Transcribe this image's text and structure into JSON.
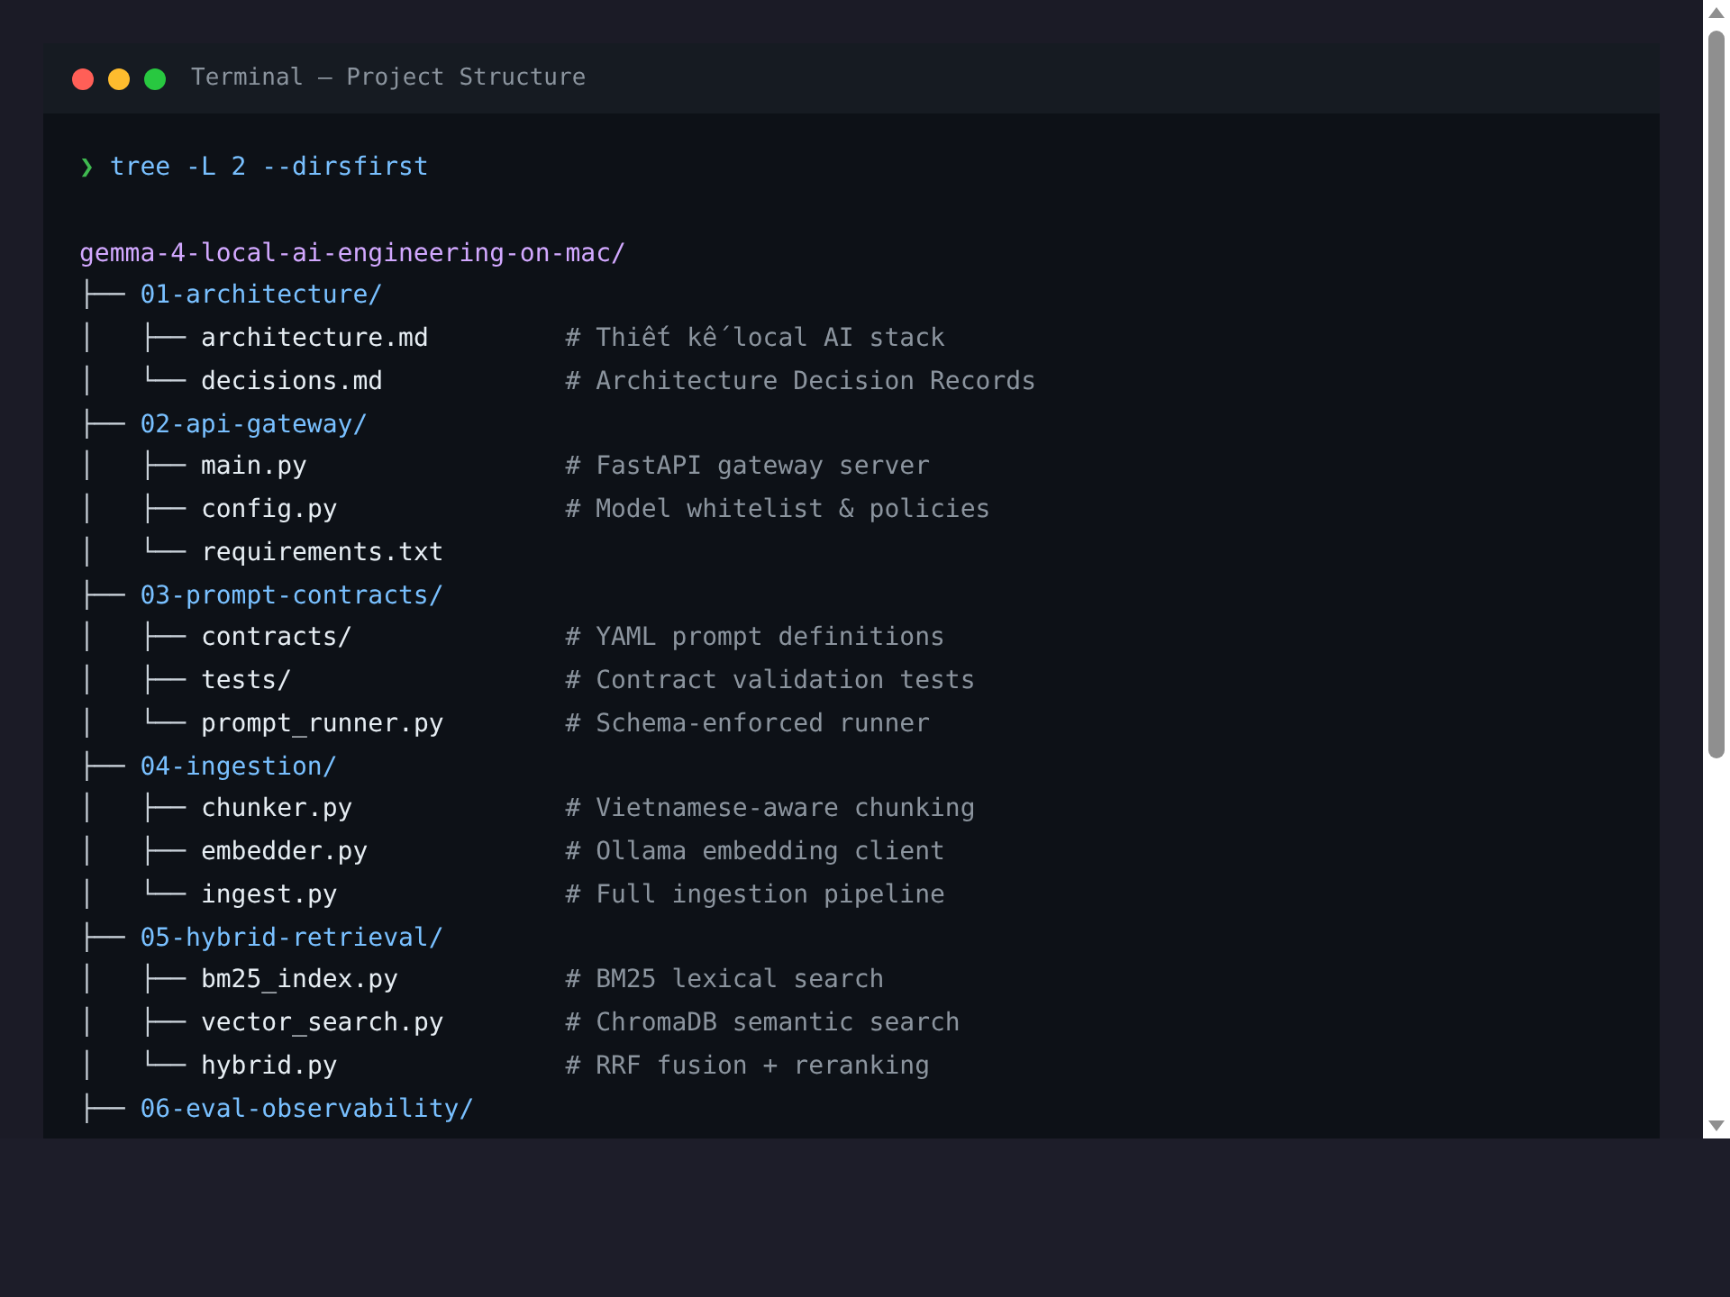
{
  "window": {
    "title": "Terminal — Project Structure"
  },
  "command": {
    "prompt": "❯",
    "text": "tree -L 2 --dirsfirst"
  },
  "tree": {
    "name": "gemma-4-local-ai-engineering-on-mac/",
    "children": [
      {
        "prefix": "├── ",
        "name": "01-architecture/",
        "children": [
          {
            "prefix": "│   ├── ",
            "name": "architecture.md",
            "comment": "# Thiết kế local AI stack"
          },
          {
            "prefix": "│   └── ",
            "name": "decisions.md",
            "comment": "# Architecture Decision Records"
          }
        ]
      },
      {
        "prefix": "├── ",
        "name": "02-api-gateway/",
        "children": [
          {
            "prefix": "│   ├── ",
            "name": "main.py",
            "comment": "# FastAPI gateway server"
          },
          {
            "prefix": "│   ├── ",
            "name": "config.py",
            "comment": "# Model whitelist & policies"
          },
          {
            "prefix": "│   └── ",
            "name": "requirements.txt"
          }
        ]
      },
      {
        "prefix": "├── ",
        "name": "03-prompt-contracts/",
        "children": [
          {
            "prefix": "│   ├── ",
            "name": "contracts/",
            "comment": "# YAML prompt definitions"
          },
          {
            "prefix": "│   ├── ",
            "name": "tests/",
            "comment": "# Contract validation tests"
          },
          {
            "prefix": "│   └── ",
            "name": "prompt_runner.py",
            "comment": "# Schema-enforced runner"
          }
        ]
      },
      {
        "prefix": "├── ",
        "name": "04-ingestion/",
        "children": [
          {
            "prefix": "│   ├── ",
            "name": "chunker.py",
            "comment": "# Vietnamese-aware chunking"
          },
          {
            "prefix": "│   ├── ",
            "name": "embedder.py",
            "comment": "# Ollama embedding client"
          },
          {
            "prefix": "│   └── ",
            "name": "ingest.py",
            "comment": "# Full ingestion pipeline"
          }
        ]
      },
      {
        "prefix": "├── ",
        "name": "05-hybrid-retrieval/",
        "children": [
          {
            "prefix": "│   ├── ",
            "name": "bm25_index.py",
            "comment": "# BM25 lexical search"
          },
          {
            "prefix": "│   ├── ",
            "name": "vector_search.py",
            "comment": "# ChromaDB semantic search"
          },
          {
            "prefix": "│   └── ",
            "name": "hybrid.py",
            "comment": "# RRF fusion + reranking"
          }
        ]
      },
      {
        "prefix": "├── ",
        "name": "06-eval-observability/"
      }
    ]
  }
}
